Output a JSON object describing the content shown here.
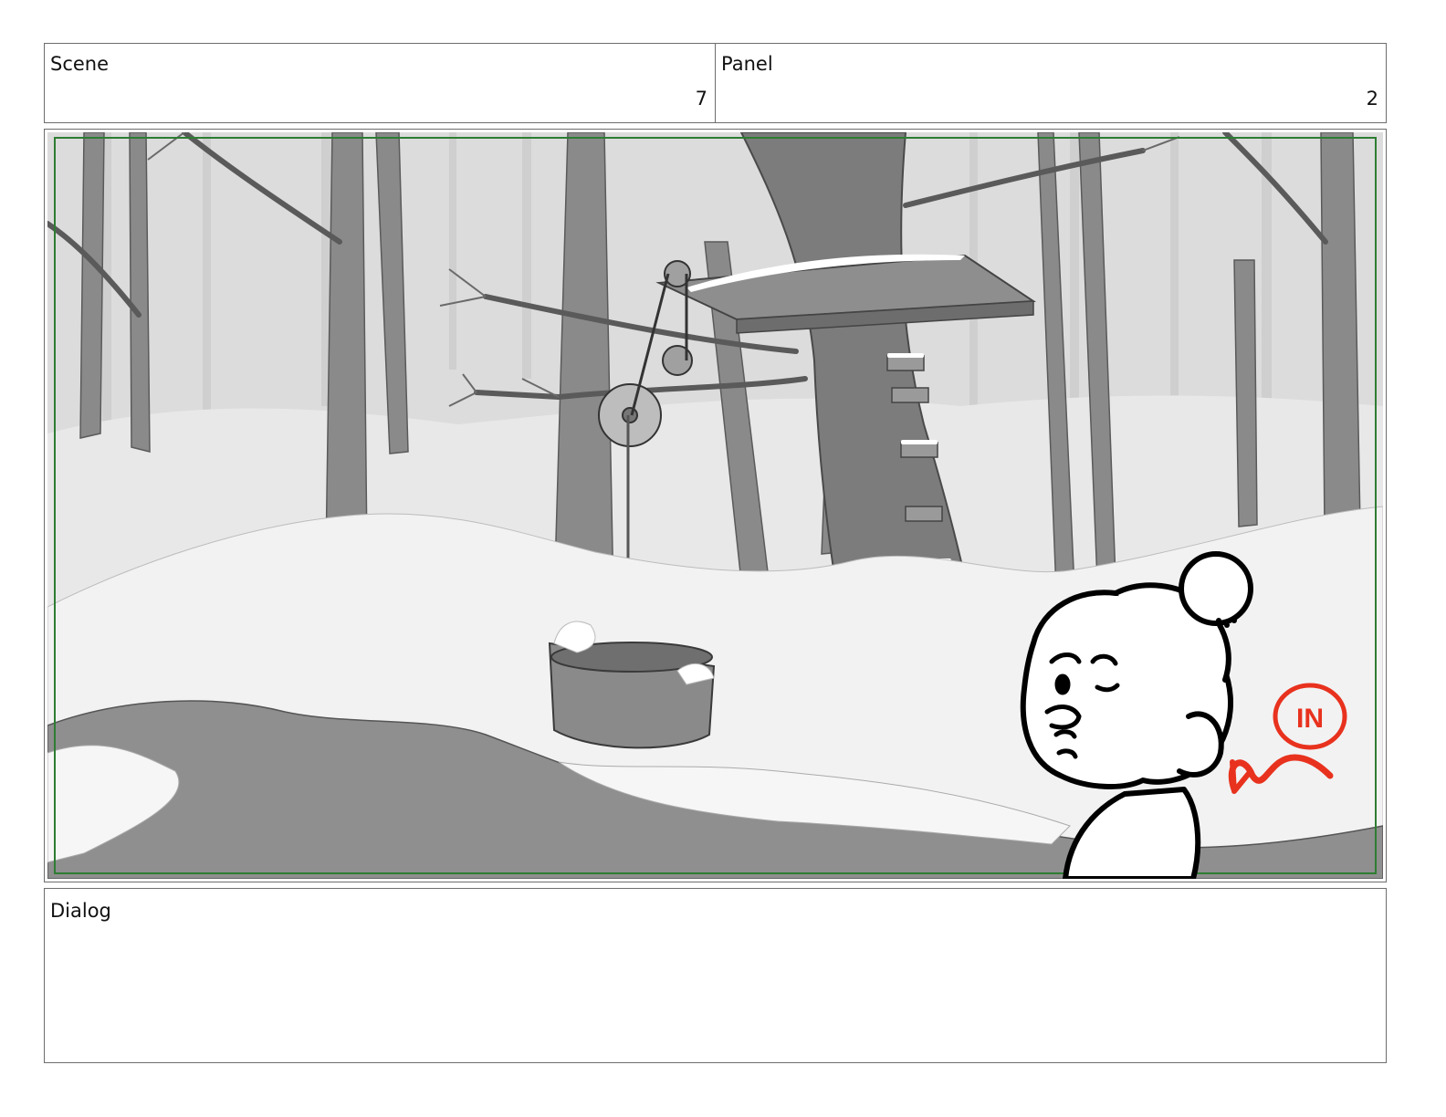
{
  "header": {
    "scene_label": "Scene",
    "scene_value": "7",
    "panel_label": "Panel",
    "panel_value": "2"
  },
  "illustration": {
    "annotation_text": "IN",
    "annotation_color": "#e8321e",
    "safe_area_color": "#2e7d32",
    "ground_color": "#f4f4f4",
    "water_color": "#8f8f8f",
    "trunk_color": "#7c7c7c"
  },
  "dialog": {
    "label": "Dialog",
    "text": ""
  }
}
